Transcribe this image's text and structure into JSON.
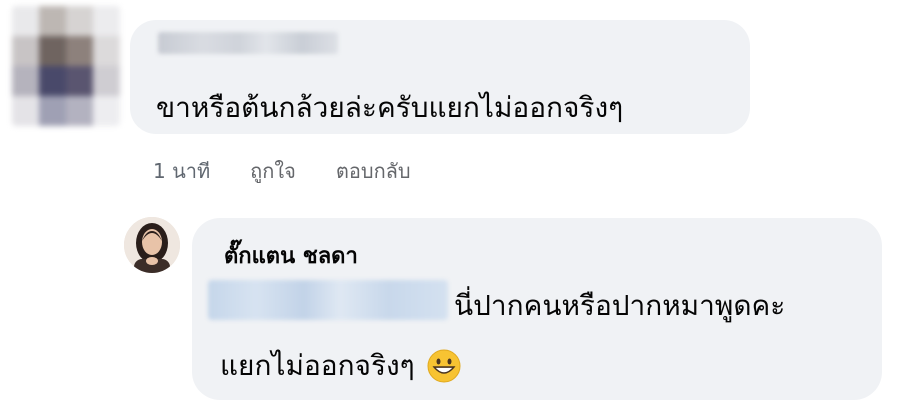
{
  "comment": {
    "author_name_redacted": true,
    "text": "ขาหรือต้นกล้วยล่ะครับแยกไม่ออกจริงๆ",
    "actions": {
      "time_ago": "1 นาที",
      "like_label": "ถูกใจ",
      "reply_label": "ตอบกลับ"
    }
  },
  "reply": {
    "author_name": "ตั๊กแตน ชลดา",
    "mention_redacted": true,
    "text_line1": "นี่ปากคนหรือปากหมาพูดคะ",
    "text_line2": "แยกไม่ออกจริงๆ",
    "emoji": "grinning-face-icon"
  },
  "colors": {
    "bubble_bg": "#f0f2f5",
    "text": "#050505",
    "meta_text": "#65676b",
    "emoji_yellow": "#f7c332"
  }
}
